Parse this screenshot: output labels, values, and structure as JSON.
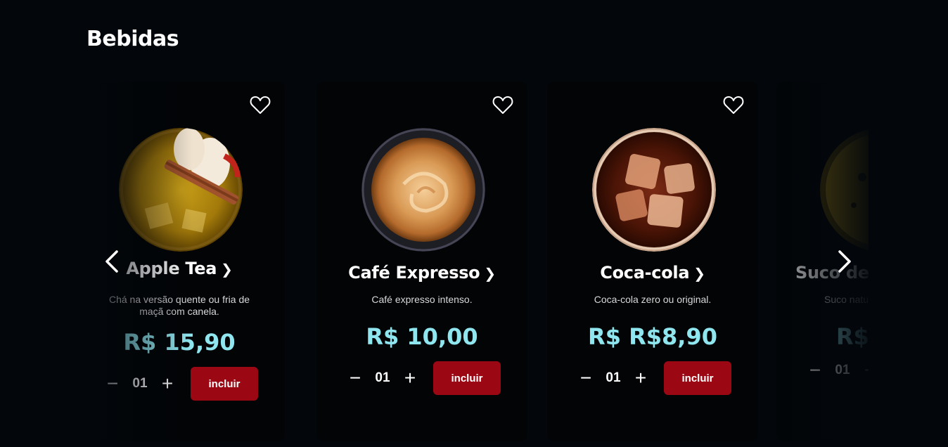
{
  "section": {
    "title": "Bebidas"
  },
  "products": [
    {
      "name": "Apple Tea",
      "description": "Chá na versão quente ou fria de maçã com canela.",
      "price": "R$ 15,90",
      "quantity": "01",
      "add_label": "incluir",
      "photo_icon": "apple-tea-photo"
    },
    {
      "name": "Café Expresso",
      "description": "Café expresso intenso.",
      "price": "R$ 10,00",
      "quantity": "01",
      "add_label": "incluir",
      "photo_icon": "espresso-photo"
    },
    {
      "name": "Coca-cola",
      "description": "Coca-cola zero ou original.",
      "price": "R$ R$8,90",
      "quantity": "01",
      "add_label": "incluir",
      "photo_icon": "cola-photo"
    },
    {
      "name": "Suco de",
      "description": "Suco natu",
      "price": "R$",
      "quantity": "01",
      "add_label": "",
      "photo_icon": "juice-photo"
    }
  ],
  "icons": {
    "favorite": "heart-outline-icon",
    "chevron": "chevron-right-icon",
    "minus": "minus-icon",
    "plus": "plus-icon",
    "prev": "chevron-left-icon",
    "next": "chevron-right-icon"
  },
  "colors": {
    "background": "#03070c",
    "card": "#020406",
    "price": "#8fe6ef",
    "add_button": "#9b0712"
  }
}
